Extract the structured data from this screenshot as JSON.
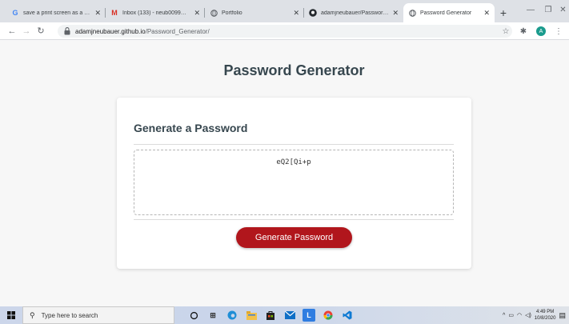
{
  "browser": {
    "tabs": [
      {
        "label": "save a print screen as a pdf",
        "icon": "google-icon"
      },
      {
        "label": "Inbox (133) - neub0099@gm",
        "icon": "gmail-icon"
      },
      {
        "label": "Portfolio",
        "icon": "globe-icon"
      },
      {
        "label": "adamjneubauer/Password...",
        "icon": "github-icon"
      },
      {
        "label": "Password Generator",
        "icon": "globe-icon",
        "active": true
      }
    ],
    "url_host": "adamjneubauer.github.io",
    "url_path": "/Password_Generator/",
    "profile_initial": "A"
  },
  "page": {
    "title": "Password Generator",
    "card_title": "Generate a Password",
    "password": "eQ2[Qi+p",
    "generate_label": "Generate Password",
    "accent": "#b1161c"
  },
  "taskbar": {
    "search_placeholder": "Type here to search",
    "time": "4:49 PM",
    "date": "10/8/2020"
  }
}
